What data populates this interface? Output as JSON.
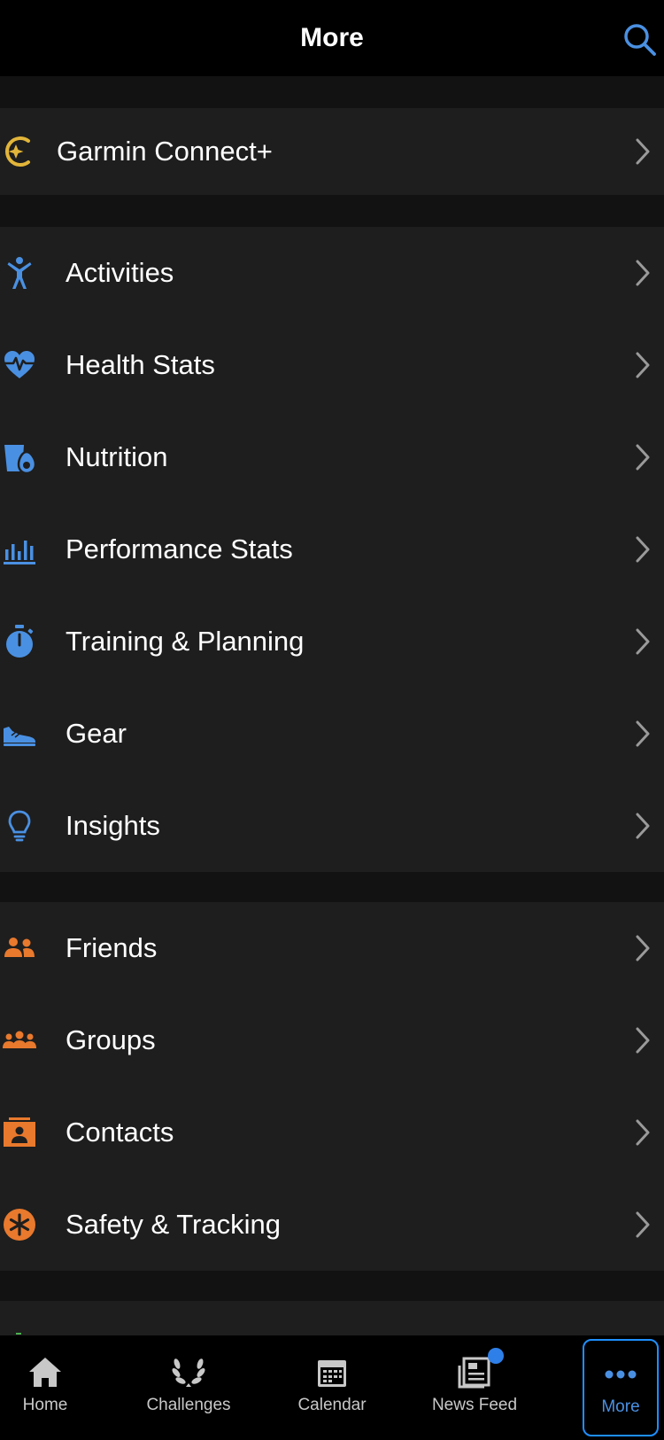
{
  "header": {
    "title": "More",
    "search_icon": "search-icon"
  },
  "colors": {
    "accent_blue": "#4a90e2",
    "orange": "#e8792d",
    "gold": "#e2b53a",
    "row_bg": "#1e1e1e",
    "page_bg": "#121212"
  },
  "premium": {
    "label": "Garmin Connect+",
    "icon": "garmin-connect-plus-icon"
  },
  "main_menu": [
    {
      "label": "Activities",
      "icon": "person-activity-icon"
    },
    {
      "label": "Health Stats",
      "icon": "heart-pulse-icon"
    },
    {
      "label": "Nutrition",
      "icon": "cup-avocado-icon"
    },
    {
      "label": "Performance Stats",
      "icon": "bar-chart-icon"
    },
    {
      "label": "Training & Planning",
      "icon": "stopwatch-icon"
    },
    {
      "label": "Gear",
      "icon": "shoe-icon"
    },
    {
      "label": "Insights",
      "icon": "lightbulb-icon"
    }
  ],
  "social_menu": [
    {
      "label": "Friends",
      "icon": "friends-icon"
    },
    {
      "label": "Groups",
      "icon": "groups-icon"
    },
    {
      "label": "Contacts",
      "icon": "contacts-icon"
    },
    {
      "label": "Safety & Tracking",
      "icon": "asterisk-icon"
    }
  ],
  "tabbar": [
    {
      "label": "Home",
      "icon": "home-icon"
    },
    {
      "label": "Challenges",
      "icon": "laurel-icon"
    },
    {
      "label": "Calendar",
      "icon": "calendar-icon"
    },
    {
      "label": "News Feed",
      "icon": "newspaper-icon"
    },
    {
      "label": "More",
      "icon": "more-dots-icon",
      "active": true
    }
  ]
}
